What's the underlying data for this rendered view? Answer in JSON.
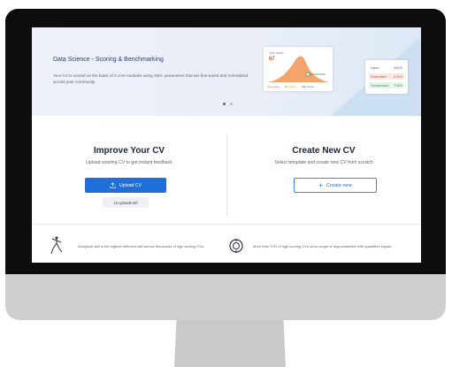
{
  "banner": {
    "title": "Data Science - Scoring & Benchmarking",
    "description": "Your CV is scored on the basis of 3 core modules using 160+ parameters that are fine-tuned and normalized across your community.",
    "chart_card": {
      "peak_label": "Your score",
      "peak_value": "67",
      "legend": [
        "Low score",
        "Mid score",
        "High score"
      ]
    },
    "score_card": {
      "rows": [
        {
          "label": "Impact",
          "value": "65/100"
        },
        {
          "label": "Presentation",
          "value": "87/100"
        },
        {
          "label": "Competencies",
          "value": "71/100"
        }
      ]
    }
  },
  "improve": {
    "title": "Improve Your CV",
    "subtitle": "Upload existing CV to get instant feedback",
    "upload_button": "Upload CV",
    "uploads_left": "10 uploads left"
  },
  "create": {
    "title": "Create New CV",
    "subtitle": "Select template and create new CV from scratch",
    "create_button": "Create new"
  },
  "stats": [
    {
      "text": "Analytical skill is the highest reflected skill across thousands of high scoring CVs."
    },
    {
      "text": "More than 70% of high scoring CVs show scope of responsibilities with quantified impact."
    }
  ],
  "colors": {
    "accent": "#1e6fd9",
    "orange": "#e2592c",
    "green": "#3b8d55"
  }
}
